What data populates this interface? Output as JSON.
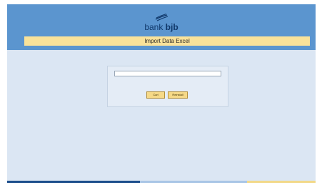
{
  "brand": {
    "name_regular": "bank ",
    "name_bold": "bjb",
    "logo_icon": "bjb-swoosh-icon",
    "colors": {
      "header": "#5b95cf",
      "title_bar": "#f9e29a",
      "background": "#dbe6f3",
      "button": "#f6d987",
      "brand_text": "#10386a"
    }
  },
  "page": {
    "title": "Import Data Excel"
  },
  "form": {
    "file_field": {
      "value": "",
      "placeholder": ""
    },
    "buttons": {
      "browse_label": "Cari",
      "reinstall_label": "Reinstall"
    }
  }
}
